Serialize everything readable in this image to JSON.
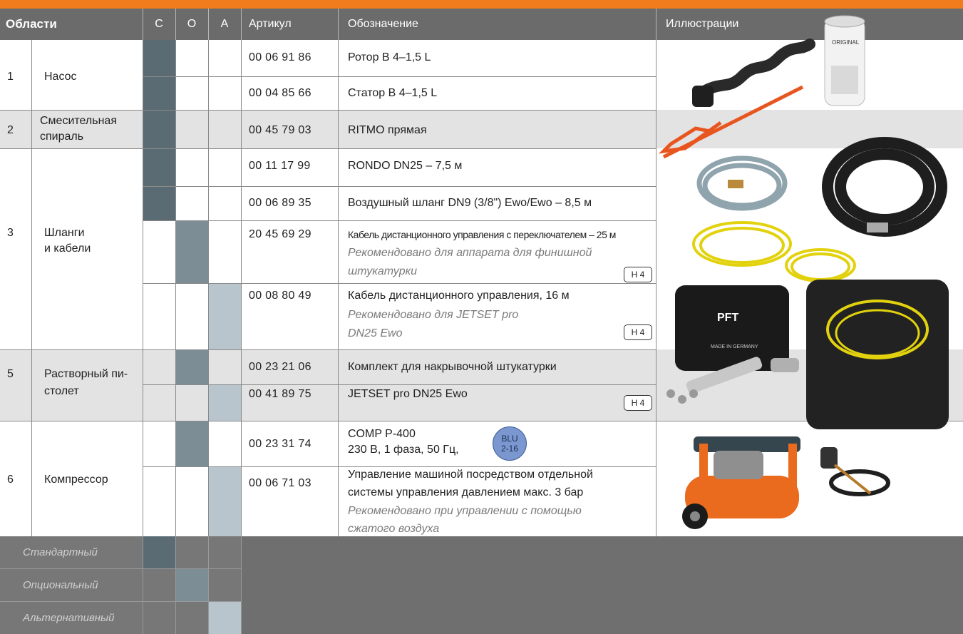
{
  "header": {
    "areas": "Области",
    "col_c": "С",
    "col_o": "О",
    "col_a": "А",
    "article": "Артикул",
    "designation": "Обозначение",
    "illustrations": "Иллюстрации"
  },
  "rows": [
    {
      "num": "1",
      "area": "Насос",
      "items": [
        {
          "article": "00 06 91 86",
          "name": "Ротор B 4–1,5 L",
          "type": "standard"
        },
        {
          "article": "00 04 85 66",
          "name": "Статор B 4–1,5 L",
          "type": "standard"
        }
      ]
    },
    {
      "num": "2",
      "area": "Смесительная спираль",
      "items": [
        {
          "article": "00 45 79 03",
          "name": "RITMO прямая",
          "type": "standard"
        }
      ]
    },
    {
      "num": "3",
      "area": "Шланги и кабели",
      "items": [
        {
          "article": "00 11 17 99",
          "name": "RONDO DN25 – 7,5 м",
          "type": "standard"
        },
        {
          "article": "00 06 89 35",
          "name": "Воздушный шланг DN9 (3/8\") Ewo/Ewo – 8,5 м",
          "type": "standard"
        },
        {
          "article": "20 45 69 29",
          "name": "Кабель дистанционного управления с переключателем – 25 м",
          "note": "Рекомендовано для аппарата для финишной штукатурки",
          "tag": "H 4",
          "type": "optional"
        },
        {
          "article": "00 08 80 49",
          "name": "Кабель дистанционного управления, 16 м",
          "note": "Рекомендовано для JETSET pro DN25 Ewo",
          "tag": "H 4",
          "type": "alternative"
        }
      ]
    },
    {
      "num": "5",
      "area": "Растворный пистолет",
      "items": [
        {
          "article": "00 23 21 06",
          "name": "Комплект для накрывочной штукатурки",
          "type": "optional"
        },
        {
          "article": "00 41 89 75",
          "name": "JETSET pro DN25 Ewo",
          "tag": "H 4",
          "type": "alternative"
        }
      ]
    },
    {
      "num": "6",
      "area": "Компрессор",
      "items": [
        {
          "article": "00 23 31 74",
          "name": "COMP P-400",
          "name2": "230 В, 1 фаза, 50 Гц,",
          "badge": "BLU 2-16",
          "type": "optional"
        },
        {
          "article": "00 06 71 03",
          "name": "Управление машиной посредством отдельной системы управления давлением макс. 3 бар",
          "note": "Рекомендовано при управлении с помощью сжатого воздуха",
          "type": "alternative"
        }
      ]
    }
  ],
  "display": {
    "area1": "Насос",
    "area2a": "Смесительная",
    "area2b": "спираль",
    "area3a": "Шланги",
    "area3b": "и кабели",
    "area5a": "Растворный пи-",
    "area5b": "столет",
    "area6": "Компрессор",
    "r3c_name": "Кабель дистанционного управления с переключателем – 25 м",
    "r3c_note1": "Рекомендовано для аппарата для финишной",
    "r3c_note2": "штукатурки",
    "r3d_note1": "Рекомендовано для JETSET pro",
    "r3d_note2": "DN25 Ewo",
    "r6b_name1": "Управление машиной посредством отдельной",
    "r6b_name2": "системы управления давлением макс. 3 бар",
    "r6b_note1": "Рекомендовано при управлении с помощью",
    "r6b_note2": "сжатого воздуха",
    "blu1": "BLU",
    "blu2": "2-16"
  },
  "legend": {
    "standard": "Стандартный",
    "optional": "Опциональный",
    "alternative": "Альтернативный"
  },
  "illustrations": {
    "pft_logo": "PFT",
    "made_in": "MADE IN GERMANY",
    "stator_label": "ORIGINAL"
  },
  "colors": {
    "accent": "#f07c1e",
    "standard": "#5a6b73",
    "optional": "#7d8d96",
    "alternative": "#b9c5cc"
  }
}
